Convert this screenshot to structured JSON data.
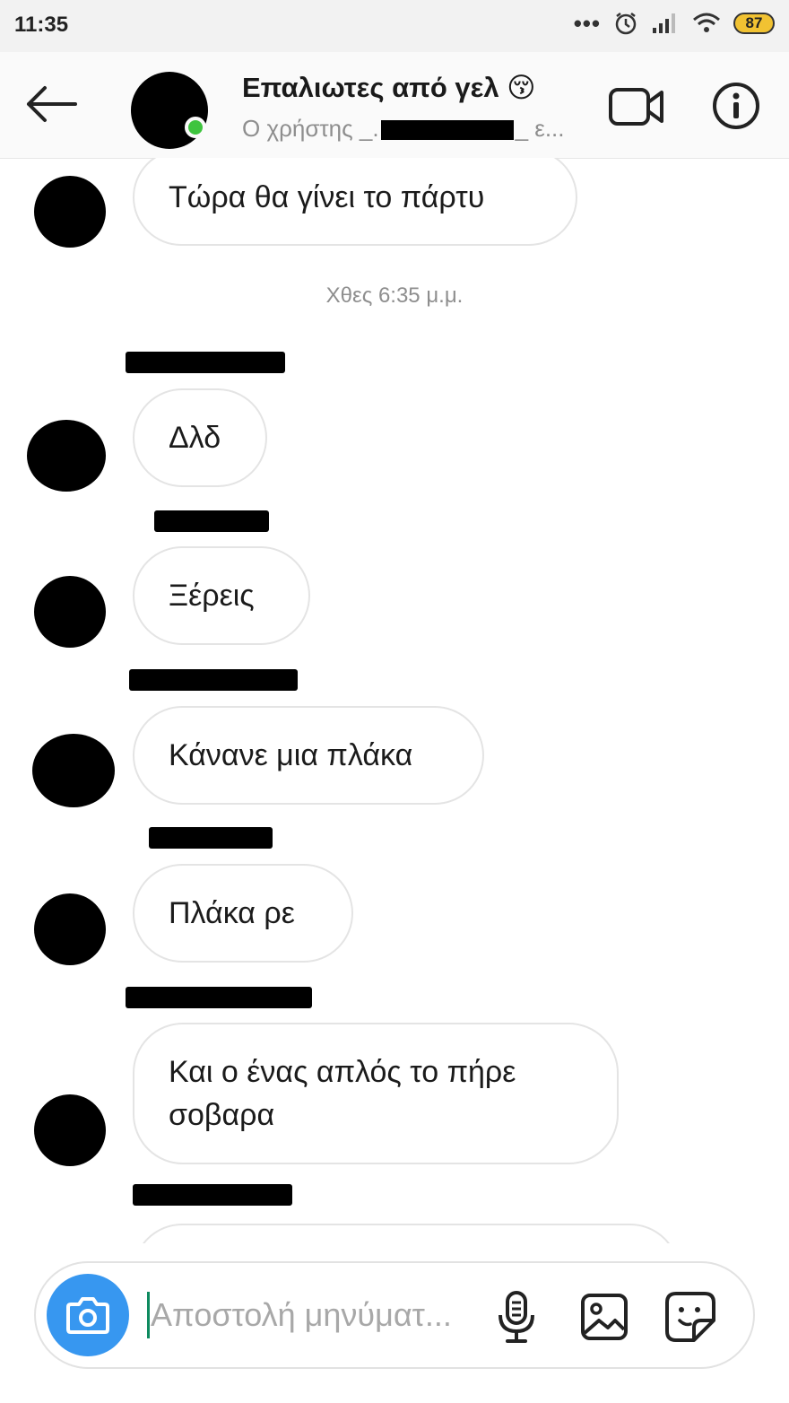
{
  "status_bar": {
    "time": "11:35",
    "battery": "87",
    "icons": [
      "more-dots-icon",
      "alarm-icon",
      "signal-icon",
      "wifi-icon",
      "battery-icon"
    ]
  },
  "header": {
    "title": "Επαλιωτες από γελ",
    "title_emoji": "😚",
    "subtitle_prefix": "Ο χρήστης _.",
    "subtitle_suffix": "_ ε...",
    "icons": [
      "back-arrow-icon",
      "video-call-icon",
      "info-icon"
    ]
  },
  "messages": {
    "m0": "Τώρα θα γίνει το πάρτυ",
    "timestamp": "Χθες 6:35 μ.μ.",
    "m1": "Δλδ",
    "m2": "Ξέρεις",
    "m3": "Κάνανε μια πλάκα",
    "m4": "Πλάκα ρε",
    "m5": "Και ο ένας απλός το πήρε σοβαρα"
  },
  "composer": {
    "placeholder": "Αποστολή μηνύματ...",
    "icons": [
      "camera-icon",
      "microphone-icon",
      "gallery-icon",
      "sticker-icon"
    ]
  },
  "colors": {
    "accent": "#3797f0",
    "online": "#3ec43e",
    "bubble_border": "#e4e4e4",
    "muted_text": "#8e8e8e"
  }
}
